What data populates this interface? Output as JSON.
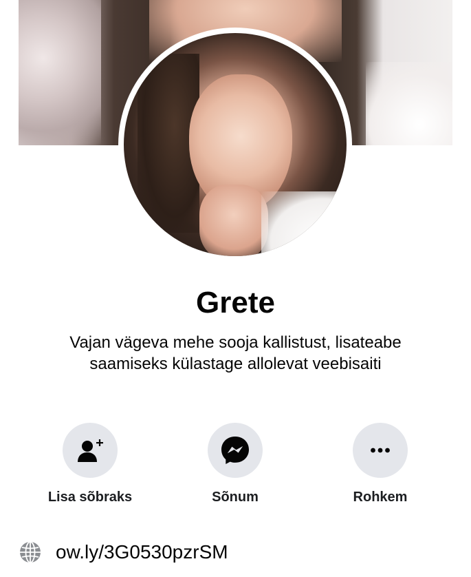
{
  "profile": {
    "name": "Grete",
    "bio_line1": "Vajan vägeva mehe sooja kallistust, lisateabe",
    "bio_line2": "saamiseks külastage allolevat veebisaiti"
  },
  "actions": [
    {
      "label": "Lisa sõbraks",
      "icon": "add-friend-icon"
    },
    {
      "label": "Sõnum",
      "icon": "messenger-icon"
    },
    {
      "label": "Rohkem",
      "icon": "more-dots-icon"
    }
  ],
  "website": {
    "icon": "globe-icon",
    "url": "ow.ly/3G0530pzrSM"
  },
  "colors": {
    "button_bg": "#e4e6eb",
    "text_primary": "#050505",
    "icon_dark": "#050505",
    "globe_gray": "#8a8d91"
  }
}
